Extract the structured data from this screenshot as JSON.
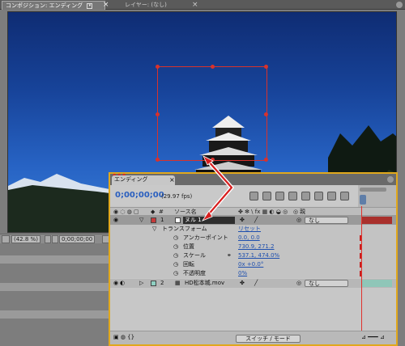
{
  "comp_panel": {
    "tab_label": "コンポジション: エンディング",
    "layer_tab_label": "レイヤー: (なし)",
    "zoom_value": "(42.8 %)",
    "time_value": "0;00;00;00"
  },
  "timeline_panel": {
    "tab_label": "エンディング",
    "current_time": "0;00;00;00",
    "fps": "(29.97 fps)",
    "columns": {
      "number": "#",
      "source_name": "ソース名",
      "parent": "親"
    },
    "layers": [
      {
        "number": "1",
        "name": "ヌル 1",
        "parent": "なし",
        "label_color": "#c63a3a"
      },
      {
        "number": "2",
        "name": "HD松本城.mov",
        "parent": "なし",
        "label_color": "#8fd0c2"
      }
    ],
    "transform": {
      "label": "トランスフォーム",
      "reset": "リセット",
      "properties": [
        {
          "name": "アンカーポイント",
          "value": "0.0, 0.0"
        },
        {
          "name": "位置",
          "value": "730.9, 271.2"
        },
        {
          "name": "スケール",
          "value": "537.1, 474.0%"
        },
        {
          "name": "回転",
          "value": "0x +0.0°"
        },
        {
          "name": "不透明度",
          "value": "0%"
        }
      ]
    },
    "footer": {
      "switch_mode": "スイッチ / モード"
    }
  },
  "icons": {
    "close": "close-icon",
    "menu": "panel-menu-icon",
    "eye": "eye-icon",
    "lock": "lock-icon",
    "expand": "triangle-expand-icon",
    "stopwatch": "stopwatch-icon",
    "pen": "pickwhip-icon",
    "search": "search-icon"
  },
  "colors": {
    "timeline_border": "#e1a81c",
    "time_blue": "#2a5fbf",
    "cti_red": "#e0322c",
    "null_bar": "#a9302c",
    "footage_bar": "#8fc6b8"
  }
}
